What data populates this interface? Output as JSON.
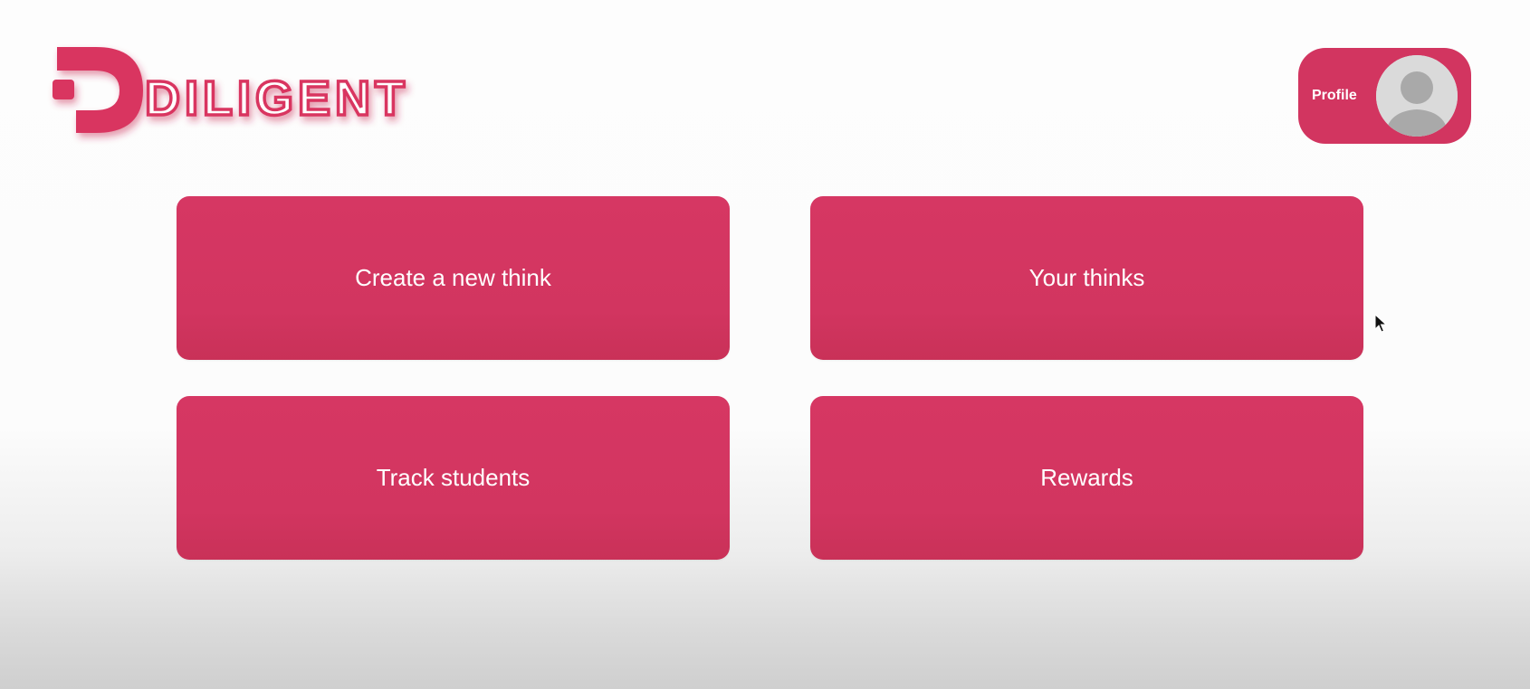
{
  "brand": {
    "logo_text": "DILIGENT",
    "accent_color": "#d23560"
  },
  "header": {
    "profile_label": "Profile",
    "avatar_icon": "default-user-avatar-icon"
  },
  "actions": [
    {
      "label": "Create a new think"
    },
    {
      "label": "Your thinks"
    },
    {
      "label": "Track students"
    },
    {
      "label": "Rewards"
    }
  ],
  "cursor": {
    "icon": "mouse-pointer-icon"
  }
}
